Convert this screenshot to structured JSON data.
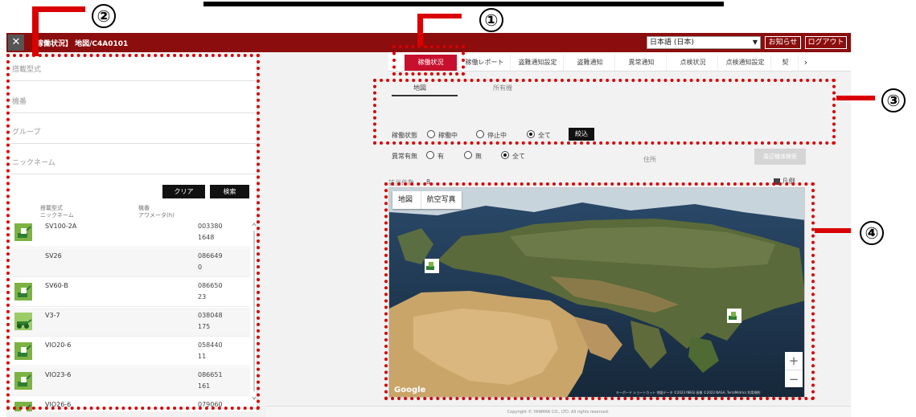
{
  "window": {
    "close_glyph": "✕",
    "title": "【稼働状況】 地図/C4A0101",
    "language_value": "日本語 (日本)",
    "notice_label": "お知らせ",
    "logout_label": "ログアウト"
  },
  "tabs": [
    {
      "label": "稼働状況",
      "active": true
    },
    {
      "label": "稼働レポート",
      "active": false
    },
    {
      "label": "盗難通知設定",
      "active": false
    },
    {
      "label": "盗難通知",
      "active": false
    },
    {
      "label": "異常通知",
      "active": false
    },
    {
      "label": "点検状況",
      "active": false
    },
    {
      "label": "点検通知設定",
      "active": false
    },
    {
      "label": "契",
      "active": false
    }
  ],
  "sidebar": {
    "fields": [
      {
        "placeholder": "搭載型式"
      },
      {
        "placeholder": "機番"
      },
      {
        "placeholder": "グループ"
      },
      {
        "placeholder": "ニックネーム"
      }
    ],
    "clear_label": "クリア",
    "search_label": "検索",
    "columns": {
      "model": "搭載型式",
      "nickname": "ニックネーム",
      "serial": "機番",
      "hourmeter": "アワメータ(h)"
    },
    "rows": [
      {
        "name": "SV100-2A",
        "serial": "003380",
        "hours": "1648",
        "icon": "excavator-icon"
      },
      {
        "name": "SV26",
        "serial": "086649",
        "hours": "0",
        "icon": ""
      },
      {
        "name": "SV60-B",
        "serial": "086650",
        "hours": "23",
        "icon": "excavator-icon"
      },
      {
        "name": "V3-7",
        "serial": "038048",
        "hours": "175",
        "icon": "wheel-loader-icon"
      },
      {
        "name": "VIO20-6",
        "serial": "058440",
        "hours": "11",
        "icon": "excavator-icon"
      },
      {
        "name": "VIO23-6",
        "serial": "086651",
        "hours": "161",
        "icon": "excavator-icon"
      },
      {
        "name": "VIO26-6",
        "serial": "079060",
        "hours": "",
        "icon": "excavator-icon"
      }
    ]
  },
  "main": {
    "subtabs": [
      "地図",
      "所有機"
    ],
    "status_label": "稼働状態",
    "status_options": [
      "稼働中",
      "停止中",
      "全て"
    ],
    "status_selected": "全て",
    "filter_label": "絞込",
    "abnormal_label": "異常有無",
    "abnormal_options": [
      "有",
      "無",
      "全て"
    ],
    "abnormal_selected": "全て",
    "address_label": "住所",
    "search_btn": "周辺機体検索",
    "count_label": "該当件数",
    "count_value": "8",
    "legend_label": "凡例",
    "map_types": [
      "地図",
      "航空写真"
    ],
    "zoom_in": "+",
    "zoom_out": "−",
    "google_logo": "Google",
    "attribution": "キーボード ショートカット 地図データ ©2023 INEGI 画像 ©2023 NASA, TerraMetrics 利用規約"
  },
  "footer": {
    "text": "Copyright © YANMAR CO., LTD. All rights reserved."
  },
  "annotations": [
    "①",
    "②",
    "③",
    "④"
  ],
  "colors": {
    "header": "#8b0d0d",
    "active_tab": "#c8102e",
    "annotation": "#d90000"
  }
}
